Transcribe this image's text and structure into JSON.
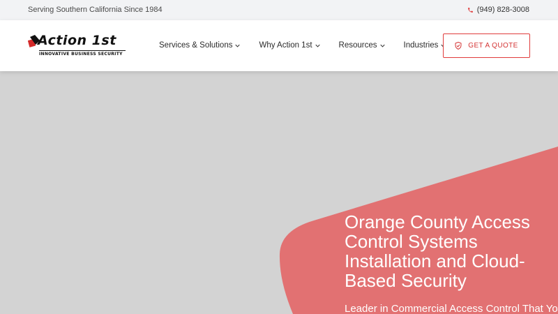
{
  "topbar": {
    "tagline": "Serving Southern California Since 1984",
    "phone": "(949) 828-3008",
    "phone_icon": "phone-icon"
  },
  "logo": {
    "wordmark": "Action 1st",
    "subtitle": "INNOVATIVE BUSINESS SECURITY"
  },
  "nav": {
    "items": [
      {
        "label": "Services & Solutions"
      },
      {
        "label": "Why Action 1st"
      },
      {
        "label": "Resources"
      },
      {
        "label": "Industries"
      }
    ],
    "dropdown_icon": "chevron-down-icon"
  },
  "cta": {
    "label": "GET A QUOTE",
    "icon": "shield-check-icon",
    "color": "#e03b3b"
  },
  "hero": {
    "title": "Orange County Access Control Systems Installation and Cloud-Based Security",
    "subtitle": "Leader in Commercial Access Control That You",
    "background_color": "#d3d3d3",
    "accent_color": "#e27172"
  }
}
